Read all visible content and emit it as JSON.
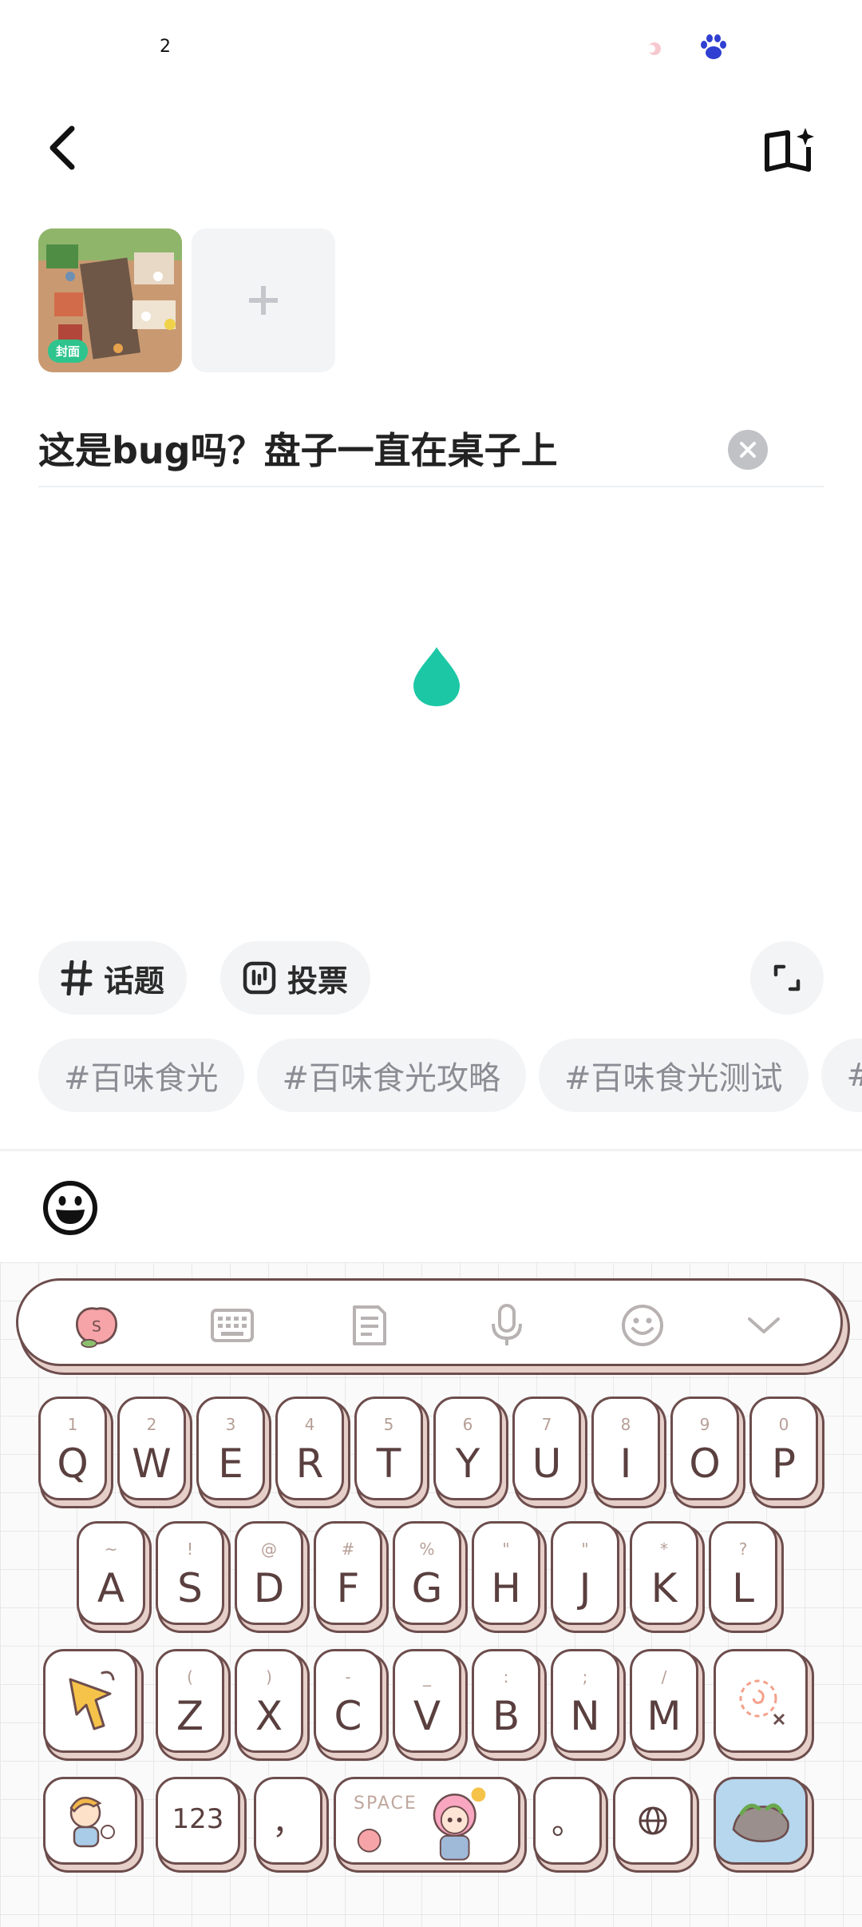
{
  "status_bar": {
    "time": "2"
  },
  "media": {
    "cover_badge": "封面"
  },
  "title": {
    "value": "这是bug吗？盘子一直在桌子上"
  },
  "tools": {
    "topic_label": "话题",
    "vote_label": "投票"
  },
  "suggested_tags": [
    "#百味食光",
    "#百味食光攻略",
    "#百味食光测试",
    "#"
  ],
  "keyboard": {
    "row1": [
      {
        "sub": "1",
        "main": "Q"
      },
      {
        "sub": "2",
        "main": "W"
      },
      {
        "sub": "3",
        "main": "E"
      },
      {
        "sub": "4",
        "main": "R"
      },
      {
        "sub": "5",
        "main": "T"
      },
      {
        "sub": "6",
        "main": "Y"
      },
      {
        "sub": "7",
        "main": "U"
      },
      {
        "sub": "8",
        "main": "I"
      },
      {
        "sub": "9",
        "main": "O"
      },
      {
        "sub": "0",
        "main": "P"
      }
    ],
    "row2": [
      {
        "sub": "~",
        "main": "A"
      },
      {
        "sub": "!",
        "main": "S"
      },
      {
        "sub": "@",
        "main": "D"
      },
      {
        "sub": "#",
        "main": "F"
      },
      {
        "sub": "%",
        "main": "G"
      },
      {
        "sub": "\"",
        "main": "H"
      },
      {
        "sub": "\"",
        "main": "J"
      },
      {
        "sub": "*",
        "main": "K"
      },
      {
        "sub": "?",
        "main": "L"
      }
    ],
    "row3": [
      {
        "sub": "(",
        "main": "Z"
      },
      {
        "sub": ")",
        "main": "X"
      },
      {
        "sub": "-",
        "main": "C"
      },
      {
        "sub": "_",
        "main": "V"
      },
      {
        "sub": ":",
        "main": "B"
      },
      {
        "sub": ";",
        "main": "N"
      },
      {
        "sub": "/",
        "main": "M"
      }
    ],
    "num_label": "123",
    "comma_label": "，",
    "space_label": "SPACE",
    "period_label": "。"
  },
  "colors": {
    "accent": "#1cc7a5",
    "badge": "#2fc48d",
    "key_border": "#6d4d4d"
  }
}
